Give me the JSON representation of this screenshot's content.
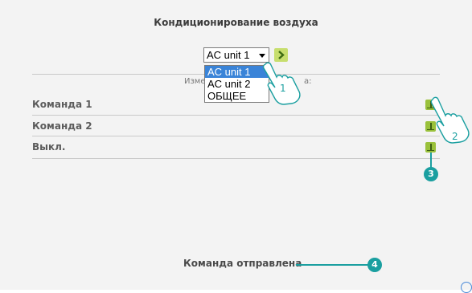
{
  "page": {
    "title": "Кондиционирование воздуха",
    "subtitle_prefix": "Изме",
    "subtitle_suffix": "а:"
  },
  "unit_select": {
    "selected": "AC unit 1",
    "options": [
      "AC unit 1",
      "AC unit 2",
      "ОБЩЕЕ"
    ]
  },
  "commands": [
    {
      "label": "Команда 1"
    },
    {
      "label": "Команда 2"
    },
    {
      "label": "Выкл."
    }
  ],
  "status_text": "Команда отправлена",
  "callouts": [
    "1",
    "2",
    "3",
    "4"
  ],
  "colors": {
    "accent": "#1a9fa0",
    "highlight": "#3a84d8",
    "button_green": "#9ac13b"
  },
  "icons": {
    "go": "arrow-right-icon",
    "send": "send-command-icon",
    "pointer": "hand-pointer-icon",
    "help": "help-circle-icon"
  }
}
